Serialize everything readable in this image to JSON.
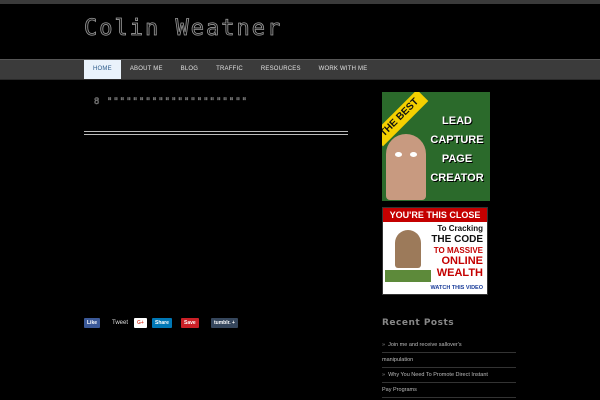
{
  "site": {
    "title": "Colin Weatner"
  },
  "nav": {
    "items": [
      {
        "label": "HOME",
        "active": true
      },
      {
        "label": "ABOUT ME"
      },
      {
        "label": "BLOG"
      },
      {
        "label": "TRAFFIC"
      },
      {
        "label": "RESOURCES"
      },
      {
        "label": "WORK WITH ME"
      }
    ]
  },
  "post": {
    "title": "8 \"\"\"\"\"\"\"\"\"\"\"\"\"\"\"\"\"\"\"\"\"\""
  },
  "share": {
    "facebook": "Like",
    "twitter": "Tweet",
    "gplus": "G+",
    "linkedin": "Share",
    "pinterest": "Save",
    "tumblr": "tumblr. +"
  },
  "ads": {
    "lead_capture": {
      "badge": "THE BEST",
      "lines": [
        "LEAD",
        "CAPTURE",
        "PAGE",
        "CREATOR"
      ]
    },
    "close": {
      "head": "YOU'RE THIS CLOSE",
      "l1": "To Cracking",
      "l2": "THE CODE",
      "l3": "TO MASSIVE",
      "l4": "ONLINE",
      "l5": "WEALTH",
      "cta": "WATCH THIS VIDEO"
    }
  },
  "sidebar": {
    "recent_title": "Recent Posts",
    "recent_posts": [
      "Join me and receive sallover's",
      "manipulation",
      "Why You Need To Promote Direct Instant",
      "Pay Programs"
    ]
  },
  "colors": {
    "nav_bg": "#3b3b3b",
    "nav_active": "#e9f2fb",
    "facebook": "#3b5998",
    "twitter": "#1da1f2",
    "gplus": "#dd4b39",
    "linkedin": "#0077b5",
    "pinterest": "#cb2027",
    "tumblr": "#35465c"
  }
}
